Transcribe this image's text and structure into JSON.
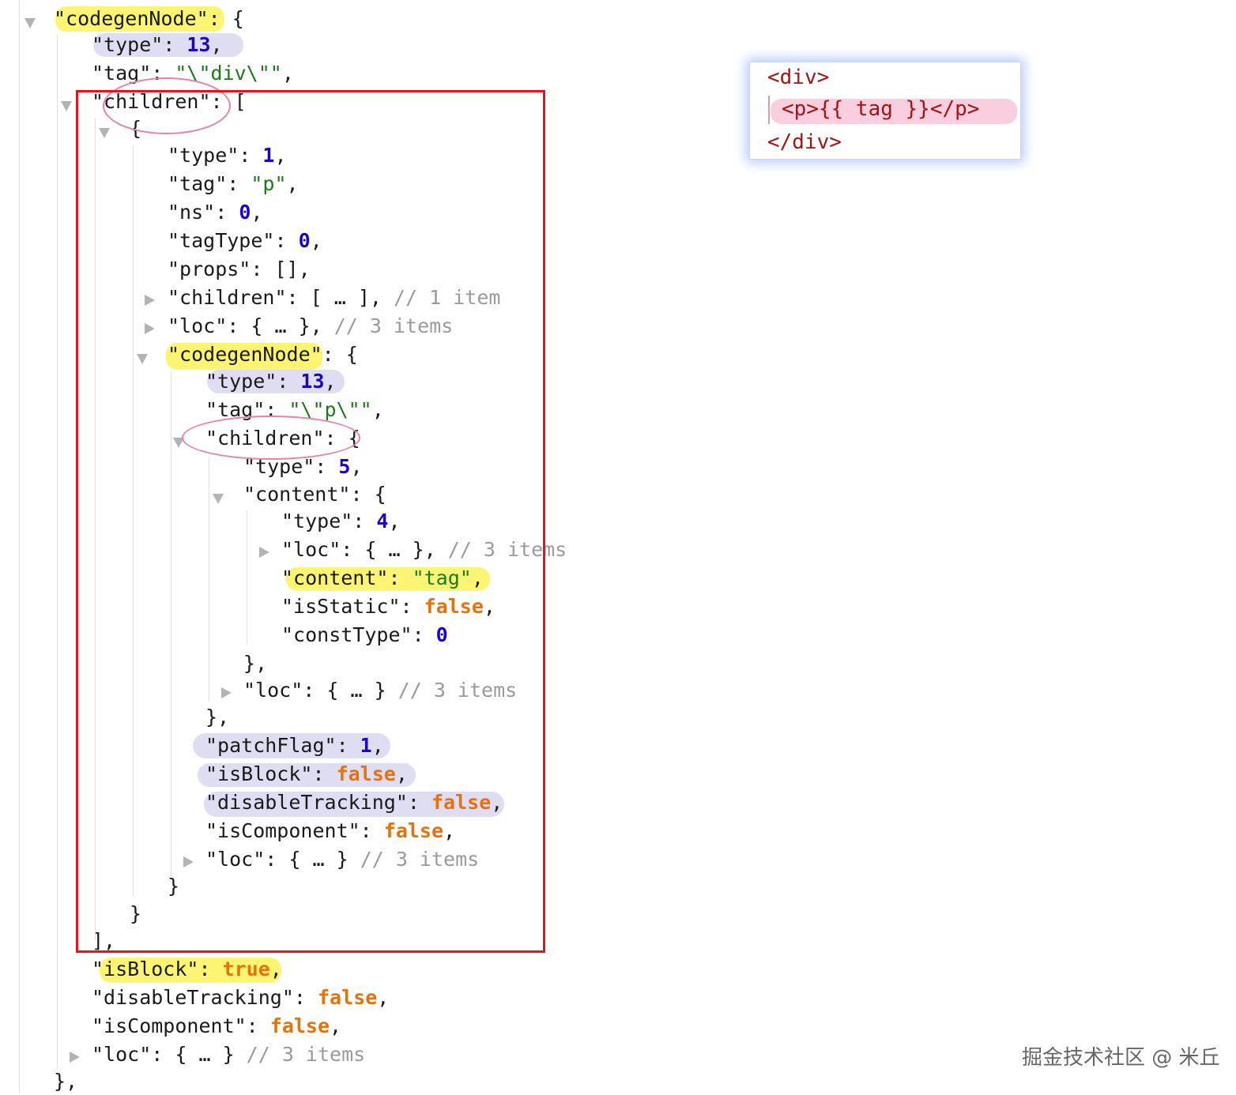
{
  "json_tree": {
    "lines": [
      {
        "key": "\"codegenNode\": ",
        "rest": "{"
      },
      {
        "key": "\"type\": ",
        "num": "13",
        "tail": ","
      },
      {
        "key": "\"tag\": ",
        "str": "\"\\\"div\\\"\"",
        "tail": ","
      },
      {
        "key": "\"children\": ",
        "rest": "["
      },
      {
        "rest": "{"
      },
      {
        "key": "\"type\": ",
        "num": "1",
        "tail": ","
      },
      {
        "key": "\"tag\": ",
        "str": "\"p\"",
        "tail": ","
      },
      {
        "key": "\"ns\": ",
        "num": "0",
        "tail": ","
      },
      {
        "key": "\"tagType\": ",
        "num": "0",
        "tail": ","
      },
      {
        "key": "\"props\": ",
        "rest": "[],"
      },
      {
        "key": "\"children\": ",
        "rest": "[ … ], ",
        "cmt": "// 1 item"
      },
      {
        "key": "\"loc\": ",
        "rest": "{ … }, ",
        "cmt": "// 3 items"
      },
      {
        "key": "\"codegenNode\": ",
        "rest": "{"
      },
      {
        "key": "\"type\": ",
        "num": "13",
        "tail": ","
      },
      {
        "key": "\"tag\": ",
        "str": "\"\\\"p\\\"\"",
        "tail": ","
      },
      {
        "key": "\"children\": ",
        "rest": "{"
      },
      {
        "key": "\"type\": ",
        "num": "5",
        "tail": ","
      },
      {
        "key": "\"content\": ",
        "rest": "{"
      },
      {
        "key": "\"type\": ",
        "num": "4",
        "tail": ","
      },
      {
        "key": "\"loc\": ",
        "rest": "{ … }, ",
        "cmt": "// 3 items"
      },
      {
        "key": "\"content\": ",
        "str": "\"tag\"",
        "tail": ","
      },
      {
        "key": "\"isStatic\": ",
        "bool": "false",
        "tail": ","
      },
      {
        "key": "\"constType\": ",
        "num": "0"
      },
      {
        "rest": "},"
      },
      {
        "key": "\"loc\": ",
        "rest": "{ … } ",
        "cmt": "// 3 items"
      },
      {
        "rest": "},"
      },
      {
        "key": "\"patchFlag\": ",
        "num": "1",
        "tail": ","
      },
      {
        "key": "\"isBlock\": ",
        "bool": "false",
        "tail": ","
      },
      {
        "key": "\"disableTracking\": ",
        "bool": "false",
        "tail": ","
      },
      {
        "key": "\"isComponent\": ",
        "bool": "false",
        "tail": ","
      },
      {
        "key": "\"loc\": ",
        "rest": "{ … } ",
        "cmt": "// 3 items"
      },
      {
        "rest": "}"
      },
      {
        "rest": "}"
      },
      {
        "rest": "],"
      },
      {
        "key": "\"isBlock\": ",
        "bool": "true",
        "tail": ","
      },
      {
        "key": "\"disableTracking\": ",
        "bool": "false",
        "tail": ","
      },
      {
        "key": "\"isComponent\": ",
        "bool": "false",
        "tail": ","
      },
      {
        "key": "\"loc\": ",
        "rest": "{ … } ",
        "cmt": "// 3 items"
      },
      {
        "rest": "},"
      }
    ]
  },
  "template_snippet": {
    "line1": "<div>",
    "line2": "<p>{{ tag }}</p>",
    "line3": "</div>"
  },
  "watermark": "掘金技术社区 @ 米丘",
  "colors": {
    "number": "#1c00cf",
    "string": "#1a7a1a",
    "boolean": "#e8710a",
    "comment": "#9a9a9a",
    "highlight_yellow": "#fbf35a",
    "highlight_purple": "#d8d7f0",
    "annotation_circle": "#ea7fa9",
    "annotation_box": "#e8131a",
    "template_text": "#a31515"
  }
}
